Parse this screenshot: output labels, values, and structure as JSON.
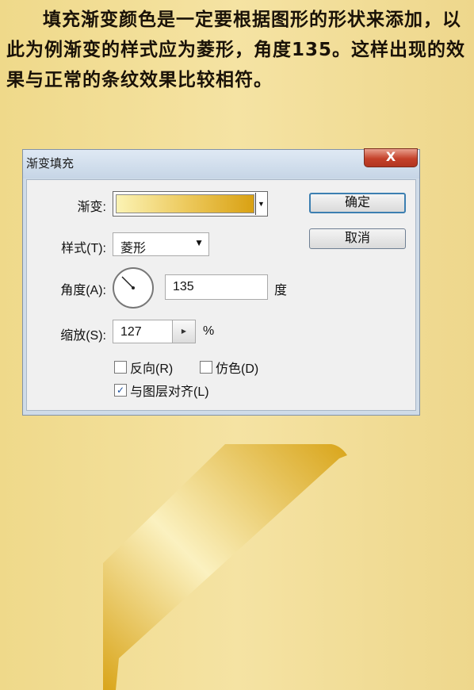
{
  "intro_text": "填充渐变颜色是一定要根据图形的形状来添加，以此为例渐变的样式应为菱形，角度135。这样出现的效果与正常的条纹效果比较相符。",
  "dialog": {
    "title": "渐变填充",
    "close_label": "X",
    "gradient_label": "渐变:",
    "gradient_colors": [
      "#fbf3b4",
      "#edca5e",
      "#d9a113"
    ],
    "style_label": "样式(T):",
    "style_value": "菱形",
    "angle_label": "角度(A):",
    "angle_value": "135",
    "angle_unit": "度",
    "scale_label": "缩放(S):",
    "scale_value": "127",
    "scale_unit": "%",
    "reverse_label": "反向(R)",
    "reverse_checked": false,
    "dither_label": "仿色(D)",
    "dither_checked": false,
    "align_label": "与图层对齐(L)",
    "align_checked": true,
    "ok_label": "确定",
    "cancel_label": "取消"
  },
  "colors": {
    "background": "#f3dfa0",
    "ribbon_dark": "#d9a51a",
    "ribbon_light": "#fbf1c0"
  }
}
